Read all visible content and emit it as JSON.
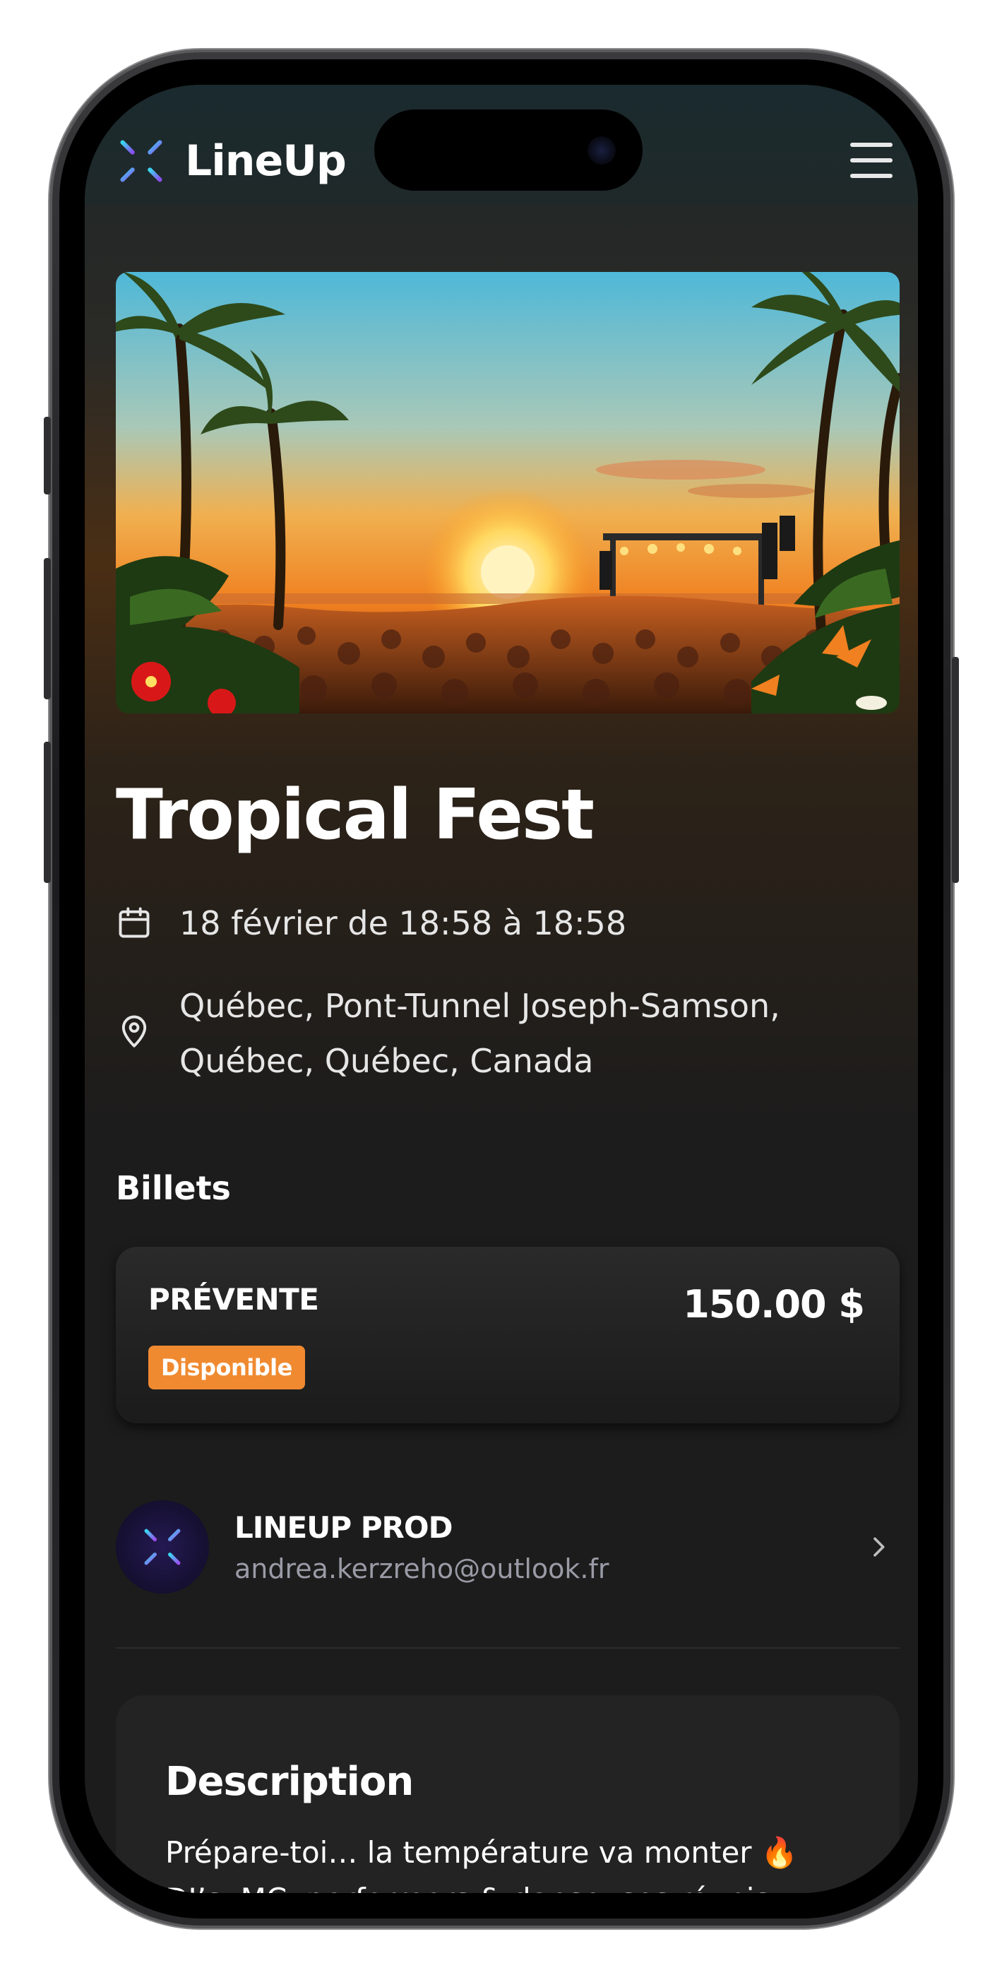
{
  "app": {
    "name": "LineUp",
    "brand_color": "#f08a30"
  },
  "event": {
    "title": "Tropical Fest",
    "date": "18 février de 18:58 à 18:58",
    "location": "Québec, Pont-Tunnel Joseph-Samson, Québec, Québec, Canada",
    "hero_image": "tropical-beach-concert-sunset"
  },
  "tickets": {
    "section_title": "Billets",
    "items": [
      {
        "name": "PRÉVENTE",
        "price": "150.00 $",
        "status": "Disponible",
        "status_color": "#f08a30"
      }
    ]
  },
  "organizer": {
    "name": "LINEUP PROD",
    "email": "andrea.kerzreho@outlook.fr"
  },
  "description": {
    "title": "Description",
    "text": "Prépare-toi… la température va monter 🔥 DJ’s, MC, performers & danseuses réunis"
  },
  "icons": {
    "menu": "hamburger-menu-icon",
    "date": "calendar-icon",
    "location": "map-pin-icon",
    "organizer_next": "chevron-right-icon"
  }
}
